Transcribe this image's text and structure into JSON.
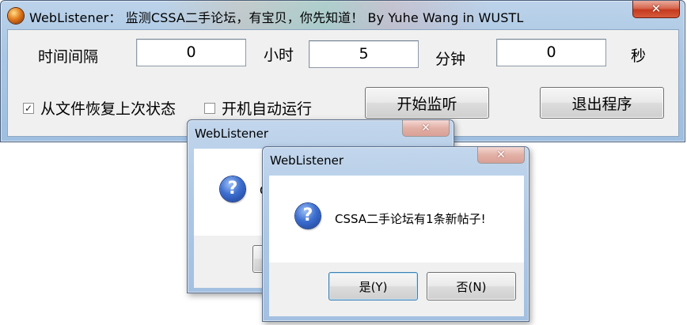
{
  "main_window": {
    "title": "WebListener： 监测CSSA二手论坛，有宝贝，你先知道！ By Yuhe Wang in WUSTL",
    "close_glyph": "✕",
    "interval_label": "时间间隔",
    "hours_value": "0",
    "hours_unit": "小时",
    "minutes_value": "5",
    "minutes_unit": "分钟",
    "seconds_value": "0",
    "seconds_unit": "秒",
    "restore_checkbox": {
      "label": "从文件恢复上次状态",
      "checked": true,
      "mark": "✓"
    },
    "autostart_checkbox": {
      "label": "开机自动运行",
      "checked": false,
      "mark": ""
    },
    "start_button": "开始监听",
    "exit_button": "退出程序"
  },
  "dialog_back": {
    "title": "WebListener",
    "close_glyph": "✕",
    "icon": "question-icon",
    "message_visible_fragment": "C"
  },
  "dialog_front": {
    "title": "WebListener",
    "close_glyph": "✕",
    "icon": "question-icon",
    "icon_glyph": "?",
    "message": "CSSA二手论坛有1条新帖子!",
    "yes_button": "是(Y)",
    "no_button": "否(N)"
  },
  "colors": {
    "window_frame": "#a9c6e4",
    "close_red": "#c53a1f",
    "client_bg": "#f0f0f0",
    "question_blue": "#3d6fd0"
  }
}
